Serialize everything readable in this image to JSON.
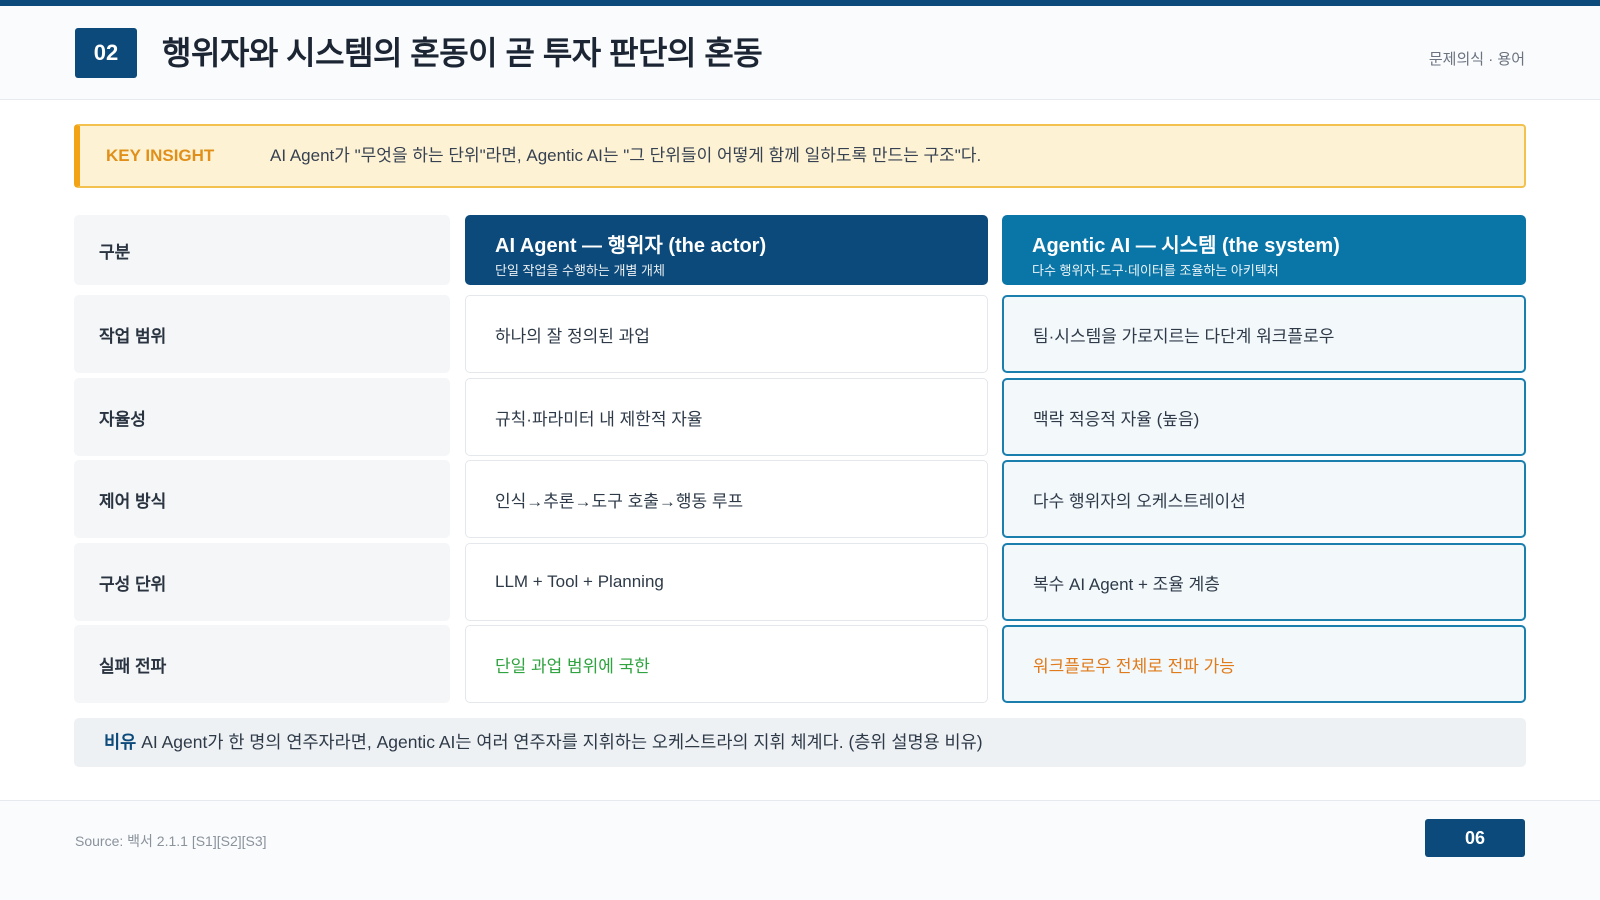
{
  "header": {
    "section_number": "02",
    "title": "행위자와 시스템의 혼동이 곧 투자 판단의 혼동",
    "tag": "문제의식 · 용어"
  },
  "insight": {
    "label": "KEY INSIGHT",
    "text": "AI Agent가 \"무엇을 하는 단위\"라면, Agentic AI는 \"그 단위들이 어떻게 함께 일하도록 만드는 구조\"다."
  },
  "table": {
    "corner_label": "구분",
    "col_a": {
      "title": "AI Agent — 행위자 (the actor)",
      "subtitle": "단일 작업을 수행하는 개별 개체"
    },
    "col_b": {
      "title": "Agentic AI — 시스템 (the system)",
      "subtitle": "다수 행위자·도구·데이터를 조율하는 아키텍처"
    },
    "rows": [
      {
        "label": "작업 범위",
        "a": "하나의 잘 정의된 과업",
        "b": "팀·시스템을 가로지르는 다단계 워크플로우"
      },
      {
        "label": "자율성",
        "a": "규칙·파라미터 내 제한적 자율",
        "b": "맥락 적응적 자율 (높음)"
      },
      {
        "label": "제어 방식",
        "a": "인식→추론→도구 호출→행동 루프",
        "b": "다수 행위자의 오케스트레이션"
      },
      {
        "label": "구성 단위",
        "a": "LLM + Tool + Planning",
        "b": "복수 AI Agent + 조율 계층"
      },
      {
        "label": "실패 전파",
        "a": "단일 과업 범위에 국한",
        "b": "워크플로우 전체로 전파 가능"
      }
    ]
  },
  "analogy": {
    "label": "비유",
    "text": "AI Agent가 한 명의 연주자라면, Agentic AI는 여러 연주자를 지휘하는 오케스트라의 지휘 체계다. (층위 설명용 비유)"
  },
  "footer": {
    "source": "Source: 백서 2.1.1 [S1][S2][S3]",
    "page_number": "06"
  },
  "colors": {
    "primary": "#0b4a7a",
    "secondary": "#0a76a8",
    "insight_accent": "#f2a316",
    "positive": "#2fa33f",
    "warning": "#e07a1a"
  }
}
